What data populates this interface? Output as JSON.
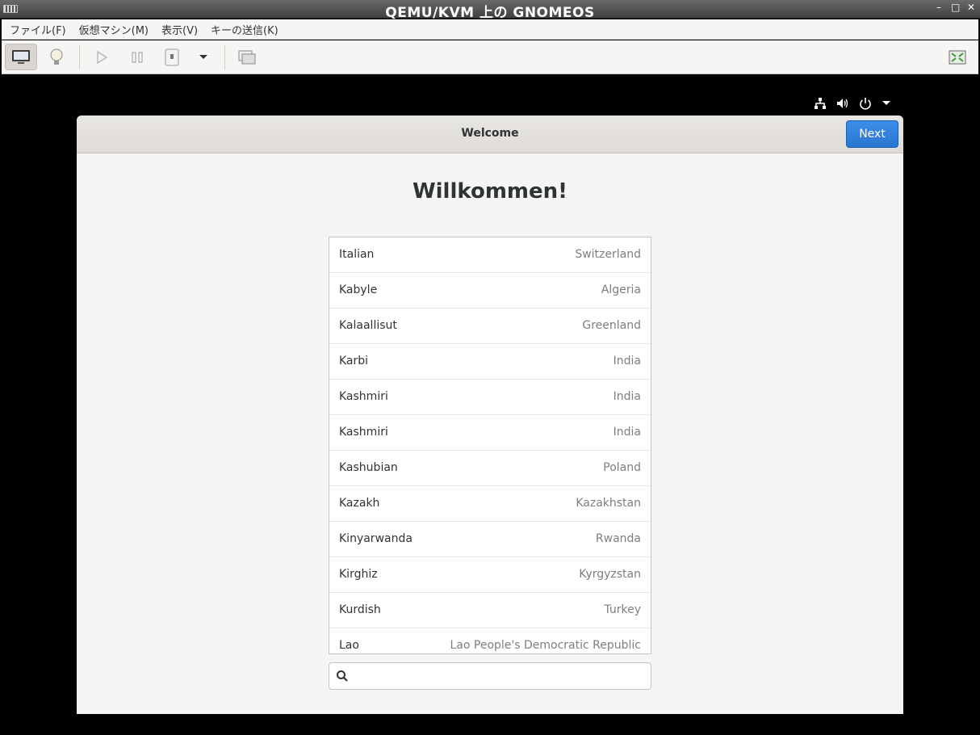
{
  "titlebar": {
    "title": "QEMU/KVM 上の GNOMEOS",
    "minimize": "–",
    "maximize": "□",
    "close": "✕"
  },
  "menubar": {
    "items": [
      "ファイル(F)",
      "仮想マシン(M)",
      "表示(V)",
      "キーの送信(K)"
    ]
  },
  "toolbar": {
    "buttons": [
      "console-icon",
      "details-icon",
      "run-icon",
      "pause-icon",
      "shutdown-icon",
      "shutdown-menu-icon",
      "snapshot-icon",
      "fullscreen-icon"
    ]
  },
  "guest_top": {
    "icons": [
      "network-icon",
      "volume-icon",
      "power-icon",
      "system-menu-arrow-icon"
    ]
  },
  "window": {
    "title": "Welcome",
    "next_label": "Next",
    "heading": "Willkommen!",
    "languages": [
      {
        "name": "Italian",
        "region": "Switzerland"
      },
      {
        "name": "Kabyle",
        "region": "Algeria"
      },
      {
        "name": "Kalaallisut",
        "region": "Greenland"
      },
      {
        "name": "Karbi",
        "region": "India"
      },
      {
        "name": "Kashmiri",
        "region": "India"
      },
      {
        "name": "Kashmiri",
        "region": "India"
      },
      {
        "name": "Kashubian",
        "region": "Poland"
      },
      {
        "name": "Kazakh",
        "region": "Kazakhstan"
      },
      {
        "name": "Kinyarwanda",
        "region": "Rwanda"
      },
      {
        "name": "Kirghiz",
        "region": "Kyrgyzstan"
      },
      {
        "name": "Kurdish",
        "region": "Turkey"
      },
      {
        "name": "Lao",
        "region": "Lao People's Democratic Republic"
      }
    ],
    "search": {
      "value": "",
      "placeholder": ""
    }
  },
  "colors": {
    "accent": "#2a76d0",
    "background": "#f6f5f4",
    "guest_bg": "#000000"
  }
}
